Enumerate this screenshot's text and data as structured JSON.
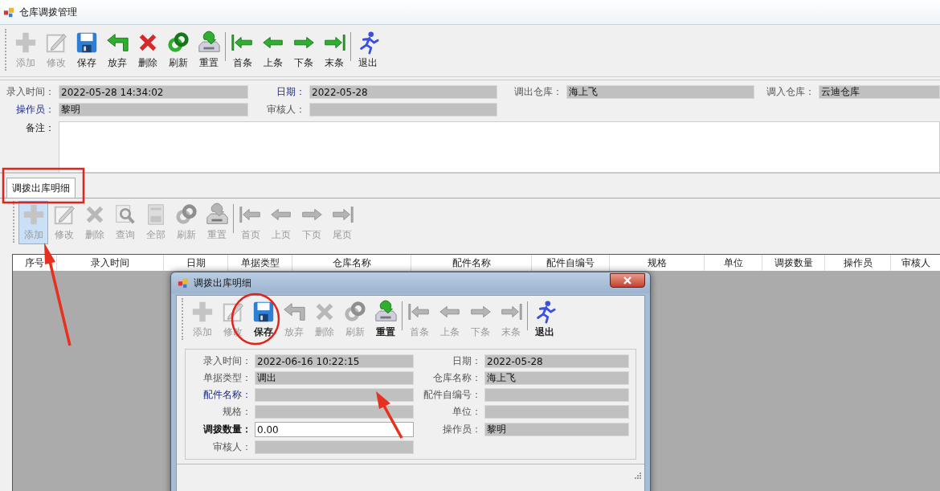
{
  "window": {
    "title": "仓库调拨管理"
  },
  "toolbar": [
    {
      "kind": "add",
      "label": "添加",
      "disabled": true
    },
    {
      "kind": "edit",
      "label": "修改",
      "disabled": true
    },
    {
      "kind": "save",
      "label": "保存",
      "disabled": false
    },
    {
      "kind": "discard",
      "label": "放弃",
      "disabled": false
    },
    {
      "kind": "delete",
      "label": "删除",
      "disabled": false
    },
    {
      "kind": "refresh",
      "label": "刷新",
      "disabled": false
    },
    {
      "kind": "reset",
      "label": "重置",
      "disabled": false
    },
    {
      "kind": "first",
      "label": "首条",
      "disabled": false
    },
    {
      "kind": "prev",
      "label": "上条",
      "disabled": false
    },
    {
      "kind": "next",
      "label": "下条",
      "disabled": false
    },
    {
      "kind": "last",
      "label": "末条",
      "disabled": false
    },
    {
      "kind": "exit",
      "label": "退出",
      "disabled": false
    }
  ],
  "form": {
    "fields": [
      {
        "label": "录入时间：",
        "value": "2022-05-28 14:34:02",
        "kind": "plain",
        "editable": false
      },
      {
        "label": "日期：",
        "value": "2022-05-28",
        "kind": "required",
        "editable": false
      },
      {
        "label": "调出仓库：",
        "value": "海上飞",
        "kind": "plain",
        "editable": false
      },
      {
        "label": "调入仓库：",
        "value": "云迪仓库",
        "kind": "plain",
        "editable": false
      },
      {
        "label": "操作员：",
        "value": "黎明",
        "kind": "required",
        "editable": false
      },
      {
        "label": "审核人：",
        "kind": "plain",
        "editable": false
      }
    ],
    "remark": {
      "label": "备注："
    }
  },
  "tabs": [
    {
      "label": "调拨出库明细",
      "selected": true
    }
  ],
  "detail_toolbar": [
    {
      "kind": "add",
      "label": "添加",
      "disabled": true,
      "highlighted": true
    },
    {
      "kind": "edit",
      "label": "修改",
      "disabled": true,
      "highlighted": false
    },
    {
      "kind": "delete",
      "label": "删除",
      "disabled": true,
      "highlighted": false
    },
    {
      "kind": "query",
      "label": "查询",
      "disabled": true,
      "highlighted": false
    },
    {
      "kind": "all",
      "label": "全部",
      "disabled": true,
      "highlighted": false
    },
    {
      "kind": "refresh",
      "label": "刷新",
      "disabled": true,
      "highlighted": false
    },
    {
      "kind": "reset",
      "label": "重置",
      "disabled": true,
      "highlighted": false
    },
    {
      "kind": "first",
      "label": "首页",
      "disabled": true,
      "highlighted": false
    },
    {
      "kind": "prev",
      "label": "上页",
      "disabled": true,
      "highlighted": false
    },
    {
      "kind": "next",
      "label": "下页",
      "disabled": true,
      "highlighted": false
    },
    {
      "kind": "last",
      "label": "尾页",
      "disabled": true,
      "highlighted": false
    }
  ],
  "table": {
    "columns": [
      "序号",
      "录入时间",
      "日期",
      "单据类型",
      "仓库名称",
      "配件名称",
      "配件自编号",
      "规格",
      "单位",
      "调拨数量",
      "操作员",
      "审核人"
    ]
  },
  "dialog": {
    "title": "调拨出库明细",
    "toolbar": [
      {
        "kind": "add",
        "label": "添加",
        "disabled": true
      },
      {
        "kind": "edit",
        "label": "修改",
        "disabled": true
      },
      {
        "kind": "save",
        "label": "保存",
        "disabled": false
      },
      {
        "kind": "discard",
        "label": "放弃",
        "disabled": true
      },
      {
        "kind": "delete",
        "label": "删除",
        "disabled": true
      },
      {
        "kind": "refresh",
        "label": "刷新",
        "disabled": true
      },
      {
        "kind": "reset",
        "label": "重置",
        "disabled": false
      },
      {
        "kind": "first",
        "label": "首条",
        "disabled": true
      },
      {
        "kind": "prev",
        "label": "上条",
        "disabled": true
      },
      {
        "kind": "next",
        "label": "下条",
        "disabled": true
      },
      {
        "kind": "last",
        "label": "末条",
        "disabled": true
      },
      {
        "kind": "exit",
        "label": "退出",
        "disabled": false
      }
    ],
    "fields": [
      {
        "label": "录入时间：",
        "value": "2022-06-16 10:22:15",
        "kind": "plain",
        "editable": false
      },
      {
        "label": "日期：",
        "value": "2022-05-28",
        "kind": "plain",
        "editable": false
      },
      {
        "label": "单据类型：",
        "value": "调出",
        "kind": "plain",
        "editable": false
      },
      {
        "label": "仓库名称：",
        "value": "海上飞",
        "kind": "plain",
        "editable": false
      },
      {
        "label": "配件名称：",
        "kind": "required",
        "editable": false
      },
      {
        "label": "配件自编号：",
        "kind": "plain",
        "editable": false
      },
      {
        "label": "规格：",
        "kind": "plain",
        "editable": false
      },
      {
        "label": "单位：",
        "kind": "plain",
        "editable": false
      },
      {
        "label": "调拨数量：",
        "value": "0.00",
        "kind": "strong",
        "editable": true
      },
      {
        "label": "操作员：",
        "value": "黎明",
        "kind": "plain",
        "editable": false
      },
      {
        "label": "审核人：",
        "kind": "plain",
        "editable": false
      }
    ]
  }
}
